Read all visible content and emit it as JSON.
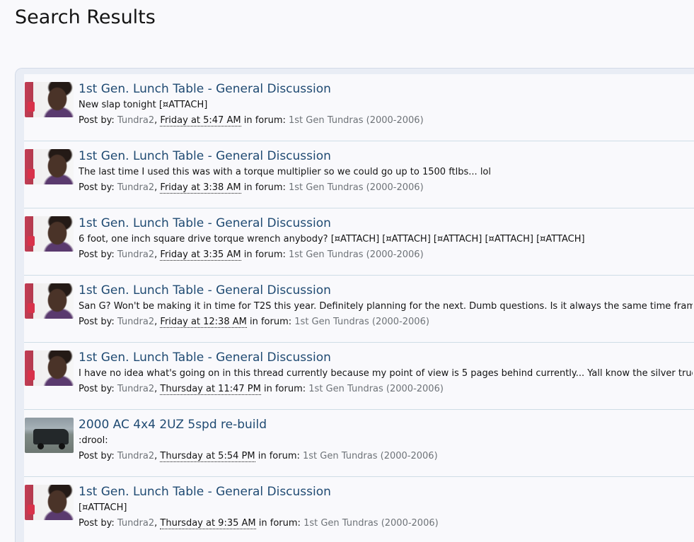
{
  "page": {
    "title": "Search Results"
  },
  "labels": {
    "post_by": "Post by:",
    "in_forum": "in forum:"
  },
  "results": [
    {
      "title": "1st Gen. Lunch Table - General Discussion",
      "snippet": "New slap tonight [¤ATTACH]",
      "author": "Tundra2",
      "date": "Friday at 5:47 AM",
      "forum": "1st Gen Tundras (2000-2006)",
      "avatar": "person-avatar"
    },
    {
      "title": "1st Gen. Lunch Table - General Discussion",
      "snippet": "The last time I used this was with a torque multiplier so we could go up to 1500 ftlbs... lol",
      "author": "Tundra2",
      "date": "Friday at 3:38 AM",
      "forum": "1st Gen Tundras (2000-2006)",
      "avatar": "person-avatar"
    },
    {
      "title": "1st Gen. Lunch Table - General Discussion",
      "snippet": "6 foot, one inch square drive torque wrench anybody? [¤ATTACH] [¤ATTACH] [¤ATTACH] [¤ATTACH] [¤ATTACH]",
      "author": "Tundra2",
      "date": "Friday at 3:35 AM",
      "forum": "1st Gen Tundras (2000-2006)",
      "avatar": "person-avatar"
    },
    {
      "title": "1st Gen. Lunch Table - General Discussion",
      "snippet": "San G? Won't be making it in time for T2S this year. Definitely planning for the next. Dumb questions. Is it always the same time frame?",
      "author": "Tundra2",
      "date": "Friday at 12:38 AM",
      "forum": "1st Gen Tundras (2000-2006)",
      "avatar": "person-avatar"
    },
    {
      "title": "1st Gen. Lunch Table - General Discussion",
      "snippet": "I have no idea what's going on in this thread currently because my point of view is 5 pages behind currently... Yall know the silver truck is...",
      "author": "Tundra2",
      "date": "Thursday at 11:47 PM",
      "forum": "1st Gen Tundras (2000-2006)",
      "avatar": "person-avatar"
    },
    {
      "title": "2000 AC 4x4 2UZ 5spd re-build",
      "snippet": ":drool:",
      "author": "Tundra2",
      "date": "Thursday at 5:54 PM",
      "forum": "1st Gen Tundras (2000-2006)",
      "avatar": "truck-avatar"
    },
    {
      "title": "1st Gen. Lunch Table - General Discussion",
      "snippet": "[¤ATTACH]",
      "author": "Tundra2",
      "date": "Thursday at 9:35 AM",
      "forum": "1st Gen Tundras (2000-2006)",
      "avatar": "person-avatar"
    }
  ]
}
